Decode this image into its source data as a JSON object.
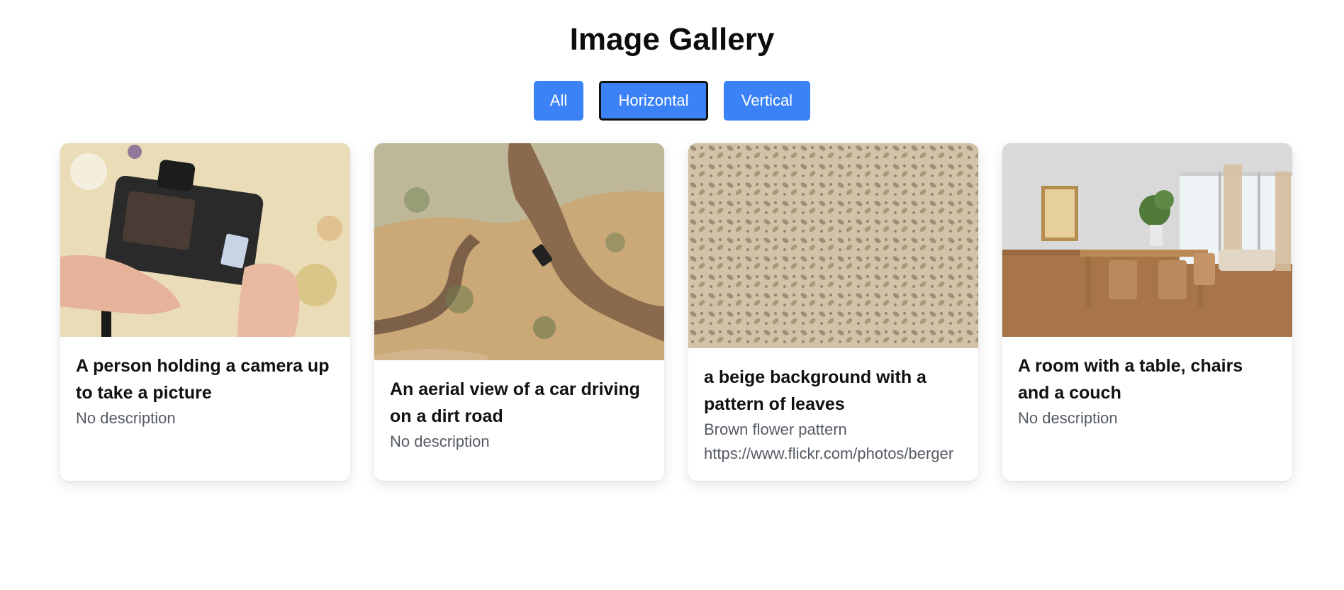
{
  "page": {
    "title": "Image Gallery"
  },
  "filters": [
    {
      "label": "All",
      "active": false
    },
    {
      "label": "Horizontal",
      "active": true
    },
    {
      "label": "Vertical",
      "active": false
    }
  ],
  "cards": [
    {
      "image_alt": "camera-photo",
      "title": "A person holding a camera up to take a picture",
      "description": "No description"
    },
    {
      "image_alt": "aerial-photo",
      "title": "An aerial view of a car driving on a dirt road",
      "description": "No description"
    },
    {
      "image_alt": "pattern-photo",
      "title": "a beige background with a pattern of leaves",
      "description": "Brown flower pattern\nhttps://www.flickr.com/photos/berger"
    },
    {
      "image_alt": "room-photo",
      "title": "A room with a table, chairs and a couch",
      "description": "No description"
    }
  ],
  "colors": {
    "accent": "#3b82f6",
    "text": "#111111",
    "muted": "#555b63"
  }
}
